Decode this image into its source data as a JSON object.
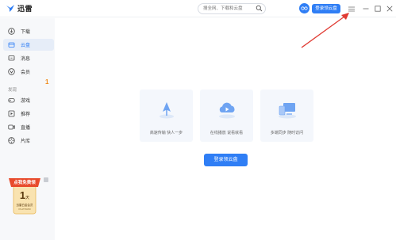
{
  "app": {
    "name": "迅雷"
  },
  "search": {
    "placeholder": "搜全网、下载和云盘"
  },
  "header": {
    "login_label": "登录领云盘"
  },
  "sidebar": {
    "items": [
      {
        "label": "下载",
        "icon": "download-icon"
      },
      {
        "label": "云盘",
        "icon": "cloud-icon",
        "active": true
      },
      {
        "label": "消息",
        "icon": "message-icon"
      },
      {
        "label": "会员",
        "icon": "vip-icon"
      }
    ],
    "section_label": "发现",
    "discover_items": [
      {
        "label": "游戏",
        "icon": "gamepad-icon"
      },
      {
        "label": "推荐",
        "icon": "recommend-icon"
      },
      {
        "label": "直播",
        "icon": "live-icon"
      },
      {
        "label": "片库",
        "icon": "film-library-icon"
      }
    ],
    "game_badge": "1",
    "promo": {
      "title": "点我免费领",
      "day": "1",
      "unit": "天",
      "line1": "迅雷白金会员",
      "line2": "PLATINUM"
    }
  },
  "main": {
    "features": [
      {
        "text": "高速传输 快人一步",
        "icon": "rocket-icon"
      },
      {
        "text": "在线播放 说看就看",
        "icon": "cloud-play-icon"
      },
      {
        "text": "多端同步 随时访问",
        "icon": "multi-device-icon"
      }
    ],
    "login_button": "登录领云盘"
  },
  "colors": {
    "accent": "#2f7ef5",
    "annotation": "#e03a32",
    "badge": "#f08a1c"
  }
}
